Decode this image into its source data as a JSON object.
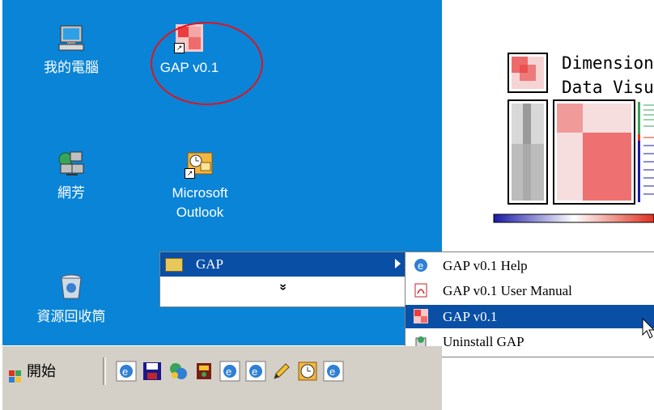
{
  "desktop": {
    "icons": [
      {
        "label": "我的電腦",
        "icon": "my-computer-icon"
      },
      {
        "label": "GAP v0.1",
        "icon": "gap-shortcut-icon"
      },
      {
        "label": "網芳",
        "icon": "network-neighborhood-icon"
      },
      {
        "label_line1": "Microsoft",
        "label_line2": "Outlook",
        "icon": "outlook-shortcut-icon"
      },
      {
        "label": "資源回收筒",
        "icon": "recycle-bin-icon"
      }
    ],
    "highlight_color": "#e0141e",
    "background_color": "#0a84d6"
  },
  "start_menu": {
    "folder_label": "GAP",
    "more_glyph": "»",
    "submenu": [
      {
        "label": "GAP v0.1 Help",
        "icon": "ie-help-icon",
        "selected": false
      },
      {
        "label": "GAP v0.1 User Manual",
        "icon": "pdf-icon",
        "selected": false
      },
      {
        "label": "GAP v0.1",
        "icon": "gap-app-icon",
        "selected": true
      },
      {
        "label": "Uninstall GAP",
        "icon": "uninstall-icon",
        "selected": false
      }
    ],
    "selection_color": "#0a4fa6"
  },
  "taskbar": {
    "start_label": "開始",
    "quick_launch": [
      "ie-icon",
      "save-icon",
      "network-icon",
      "book-icon",
      "ie-icon",
      "ie-icon",
      "pencil-icon",
      "clock-icon",
      "ie-icon"
    ]
  },
  "logo": {
    "line1": "Dimension",
    "line2": "Data Visu"
  }
}
